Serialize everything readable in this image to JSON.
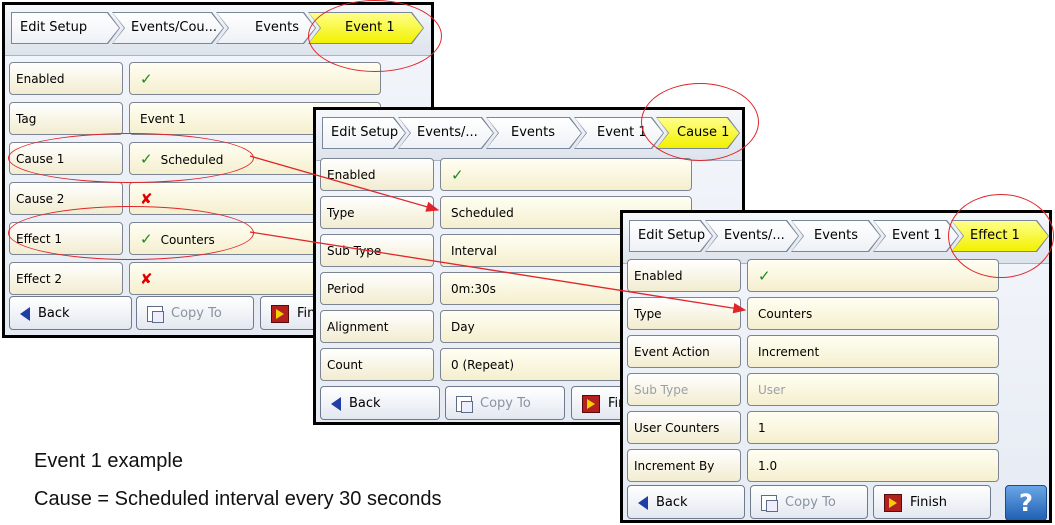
{
  "screen1": {
    "breadcrumbs": [
      "Edit Setup",
      "Events/Cou...",
      "Events",
      "Event 1"
    ],
    "rows": [
      {
        "label": "Enabled",
        "value": "",
        "status": "check"
      },
      {
        "label": "Tag",
        "value": "Event 1",
        "status": ""
      },
      {
        "label": "Cause 1",
        "value": "Scheduled",
        "status": "check"
      },
      {
        "label": "Cause 2",
        "value": "",
        "status": "cross"
      },
      {
        "label": "Effect 1",
        "value": "Counters",
        "status": "check"
      },
      {
        "label": "Effect 2",
        "value": "",
        "status": "cross"
      }
    ],
    "buttons": {
      "back": "Back",
      "copy": "Copy To",
      "finish": "Finish"
    }
  },
  "screen2": {
    "breadcrumbs": [
      "Edit Setup",
      "Events/...",
      "Events",
      "Event 1",
      "Cause 1"
    ],
    "rows": [
      {
        "label": "Enabled",
        "value": "",
        "status": "check"
      },
      {
        "label": "Type",
        "value": "Scheduled",
        "status": ""
      },
      {
        "label": "Sub Type",
        "value": "Interval",
        "status": ""
      },
      {
        "label": "Period",
        "value": "0m:30s",
        "status": ""
      },
      {
        "label": "Alignment",
        "value": "Day",
        "status": ""
      },
      {
        "label": "Count",
        "value": "0 (Repeat)",
        "status": ""
      }
    ],
    "buttons": {
      "back": "Back",
      "copy": "Copy To",
      "finish": "Finish"
    }
  },
  "screen3": {
    "breadcrumbs": [
      "Edit Setup",
      "Events/...",
      "Events",
      "Event 1",
      "Effect 1"
    ],
    "rows": [
      {
        "label": "Enabled",
        "value": "",
        "status": "check"
      },
      {
        "label": "Type",
        "value": "Counters",
        "status": ""
      },
      {
        "label": "Event Action",
        "value": "Increment",
        "status": ""
      },
      {
        "label": "Sub Type",
        "value": "User",
        "status": "",
        "disabled": true
      },
      {
        "label": "User Counters",
        "value": "1",
        "status": ""
      },
      {
        "label": "Increment By",
        "value": "1.0",
        "status": ""
      }
    ],
    "buttons": {
      "back": "Back",
      "copy": "Copy To",
      "finish": "Finish",
      "help": "?"
    }
  },
  "captions": {
    "line1": "Event 1 example",
    "line2": "Cause = Scheduled interval every 30 seconds"
  },
  "colors": {
    "annotation": "#e0262a",
    "active_crumb": "#f2f100",
    "check": "#1d8a1d",
    "cross": "#e00000"
  }
}
